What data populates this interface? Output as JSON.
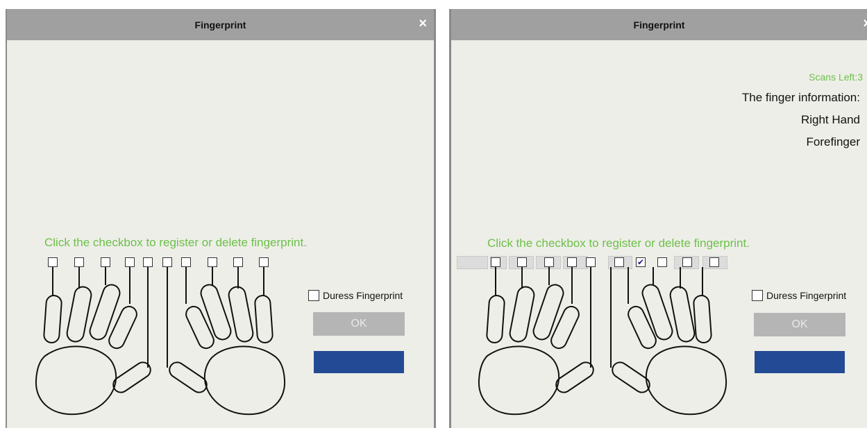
{
  "dialog_left": {
    "title": "Fingerprint",
    "close_glyph": "×",
    "instruction": "Click the checkbox to register or delete fingerprint.",
    "duress_label": "Duress Fingerprint",
    "ok_label": "OK",
    "checked_fingers": []
  },
  "dialog_right": {
    "title": "Fingerprint",
    "close_glyph": "×",
    "scans_left": "Scans Left:3",
    "info_heading": "The finger information:",
    "hand": "Right Hand",
    "finger": "Forefinger",
    "instruction": "Click the checkbox to register or delete fingerprint.",
    "duress_label": "Duress Fingerprint",
    "ok_label": "OK",
    "checked_fingers": [
      6
    ]
  },
  "check_glyph": "✔",
  "colors": {
    "accent_green": "#6cc04a",
    "title_gray": "#a0a0a0",
    "primary_blue": "#234a95",
    "disabled_gray": "#b5b5b5"
  }
}
